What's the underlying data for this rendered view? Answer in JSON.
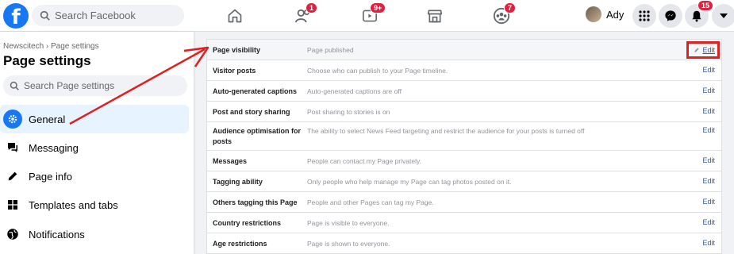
{
  "header": {
    "search_placeholder": "Search Facebook",
    "badges": {
      "friends": "1",
      "watch": "9+",
      "groups": "7",
      "notifications": "15"
    },
    "profile_name": "Ady"
  },
  "sidebar": {
    "breadcrumb": "Newscitech › Page settings",
    "title": "Page settings",
    "search_placeholder": "Search Page settings",
    "items": [
      {
        "label": "General",
        "icon": "gear-icon",
        "active": true
      },
      {
        "label": "Messaging",
        "icon": "chat-bubble-icon"
      },
      {
        "label": "Page info",
        "icon": "pencil-icon"
      },
      {
        "label": "Templates and tabs",
        "icon": "grid-icon"
      },
      {
        "label": "Notifications",
        "icon": "globe-icon"
      }
    ]
  },
  "settings": {
    "edit_label": "Edit",
    "rows": [
      {
        "label": "Page visibility",
        "value": "Page published"
      },
      {
        "label": "Visitor posts",
        "value": "Choose who can publish to your Page timeline."
      },
      {
        "label": "Auto-generated captions",
        "value": "Auto-generated captions are off"
      },
      {
        "label": "Post and story sharing",
        "value": "Post sharing to stories is on"
      },
      {
        "label": "Audience optimisation for posts",
        "value": "The ability to select News Feed targeting and restrict the audience for your posts is turned off"
      },
      {
        "label": "Messages",
        "value": "People can contact my Page privately."
      },
      {
        "label": "Tagging ability",
        "value": "Only people who help manage my Page can tag photos posted on it."
      },
      {
        "label": "Others tagging this Page",
        "value": "People and other Pages can tag my Page."
      },
      {
        "label": "Country restrictions",
        "value": "Page is visible to everyone."
      },
      {
        "label": "Age restrictions",
        "value": "Page is shown to everyone."
      }
    ]
  },
  "colors": {
    "brand": "#1877f2",
    "badge": "#e41e3f",
    "annotation": "#e02020",
    "link": "#385898"
  }
}
